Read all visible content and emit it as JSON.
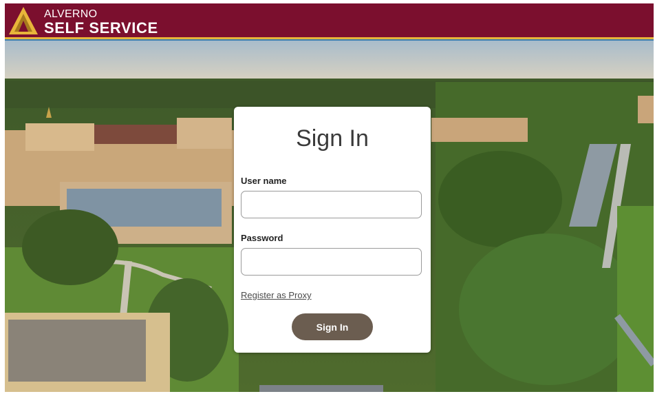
{
  "header": {
    "brand_line1": "ALVERNO",
    "brand_line2": "SELF SERVICE",
    "bar_color": "#7b0f2e",
    "accent_gold": "#e8b53a",
    "accent_blue": "#3f7fae"
  },
  "background": {
    "description_icon": "campus-aerial-photo"
  },
  "signin": {
    "title": "Sign In",
    "username_label": "User name",
    "username_value": "",
    "password_label": "Password",
    "password_value": "",
    "proxy_link": "Register as Proxy",
    "button_label": "Sign In",
    "button_color": "#6b5d50"
  }
}
